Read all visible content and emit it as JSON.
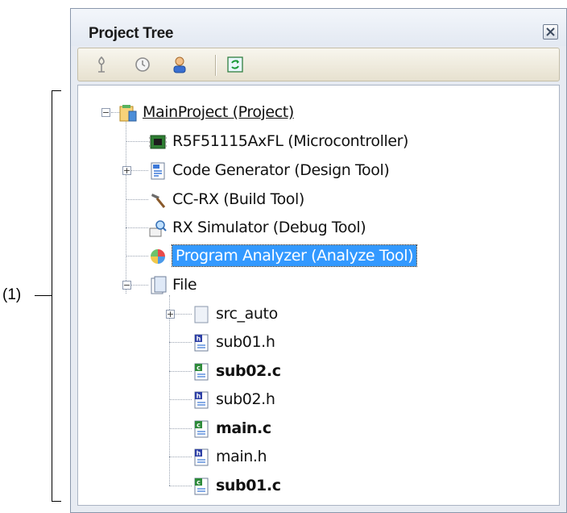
{
  "annotation": {
    "label": "(1)"
  },
  "panel": {
    "title": "Project Tree",
    "toolbar": [
      "add-file-icon",
      "properties-icon",
      "user-icon",
      "refresh-icon"
    ]
  },
  "tree": {
    "root": {
      "label": "MainProject (Project)",
      "icon": "project-icon"
    },
    "items": [
      {
        "label": "R5F51115AxFL (Microcontroller)",
        "icon": "microcontroller-icon"
      },
      {
        "label": "Code Generator (Design Tool)",
        "icon": "code-generator-icon"
      },
      {
        "label": "CC-RX (Build Tool)",
        "icon": "hammer-icon"
      },
      {
        "label": "RX Simulator (Debug Tool)",
        "icon": "simulator-icon"
      },
      {
        "label": "Program Analyzer (Analyze Tool)",
        "icon": "analyzer-icon"
      },
      {
        "label": "File",
        "icon": "folder-icon"
      }
    ],
    "files": [
      {
        "label": "src_auto",
        "icon": "folder-icon"
      },
      {
        "label": "sub01.h",
        "icon": "header-file-icon"
      },
      {
        "label": "sub02.c",
        "icon": "c-file-icon"
      },
      {
        "label": "sub02.h",
        "icon": "header-file-icon"
      },
      {
        "label": "main.c",
        "icon": "c-file-icon"
      },
      {
        "label": "main.h",
        "icon": "header-file-icon"
      },
      {
        "label": "sub01.c",
        "icon": "c-file-icon"
      }
    ]
  }
}
